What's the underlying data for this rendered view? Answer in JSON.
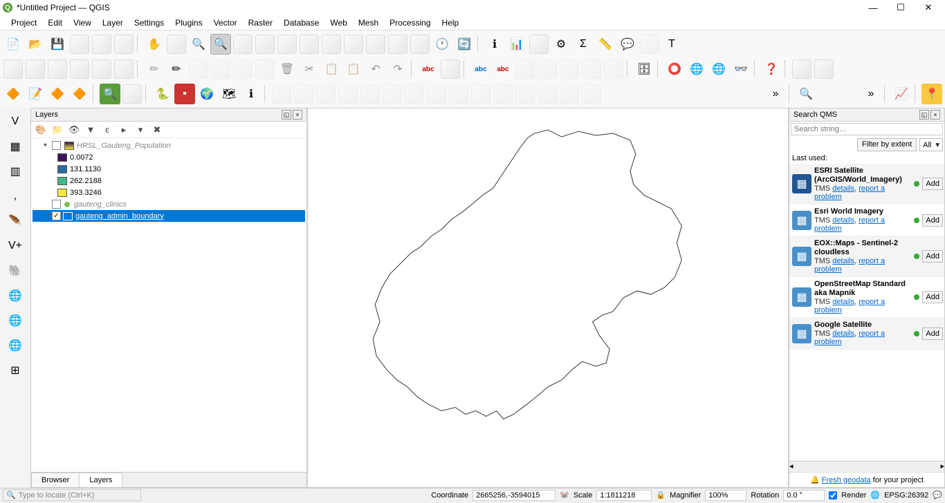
{
  "window": {
    "title": "*Untitled Project — QGIS",
    "app_icon_letter": "Q"
  },
  "menu": [
    "Project",
    "Edit",
    "View",
    "Layer",
    "Settings",
    "Plugins",
    "Vector",
    "Raster",
    "Database",
    "Web",
    "Mesh",
    "Processing",
    "Help"
  ],
  "layers_panel": {
    "title": "Layers",
    "tabs": [
      "Browser",
      "Layers"
    ],
    "active_tab": "Layers",
    "raster_group": {
      "name": "HRSL_Gauteng_Population",
      "classes": [
        {
          "color": "#3a1458",
          "label": "0.0072"
        },
        {
          "color": "#2f6aa0",
          "label": "131.1130"
        },
        {
          "color": "#3fba8d",
          "label": "262.2188"
        },
        {
          "color": "#f2e93c",
          "label": "393.3246"
        }
      ]
    },
    "point_layer": {
      "name": "gauteng_clinics",
      "color": "#7bbf5a"
    },
    "selected_layer": "gauteng_admin_boundary"
  },
  "qms": {
    "title": "Search QMS",
    "placeholder": "Search string…",
    "filter_btn": "Filter by extent",
    "filter_sel": "All",
    "last_used": "Last used:",
    "tms_label": "TMS",
    "details_label": "details",
    "report_label": "report a problem",
    "add_label": "Add",
    "items": [
      {
        "name": "ESRI Satellite (ArcGIS/World_Imagery)",
        "thumb_bg": "#205493"
      },
      {
        "name": "Esri World Imagery",
        "thumb_bg": "#4a90c8"
      },
      {
        "name": "EOX::Maps - Sentinel-2 cloudless",
        "thumb_bg": "#4a90c8"
      },
      {
        "name": "OpenStreetMap Standard aka Mapnik",
        "thumb_bg": "#4a90c8"
      },
      {
        "name": "Google Satellite",
        "thumb_bg": "#4a90c8"
      }
    ],
    "footer_link": "Fresh geodata",
    "footer_text": " for your project"
  },
  "status": {
    "locator_placeholder": "Type to locate (Ctrl+K)",
    "coord_label": "Coordinate",
    "coord_value": "2665256,-3594015",
    "scale_label": "Scale",
    "scale_value": "1:1811218",
    "mag_label": "Magnifier",
    "mag_value": "100%",
    "rot_label": "Rotation",
    "rot_value": "0.0 °",
    "render_label": "Render",
    "crs": "EPSG:26392"
  }
}
